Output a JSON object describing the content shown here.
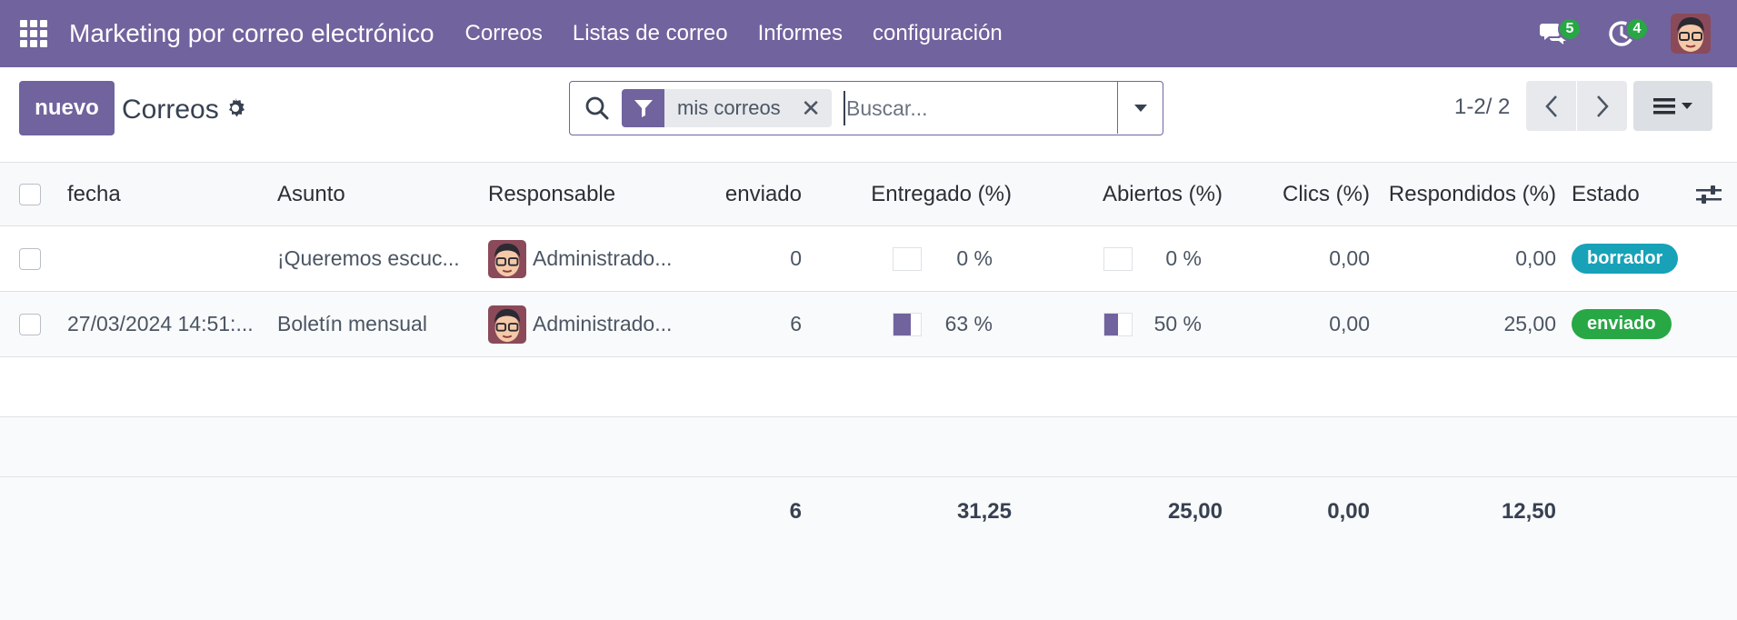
{
  "navbar": {
    "app_title": "Marketing por correo electrónico",
    "menu": [
      "Correos",
      "Listas de correo",
      "Informes",
      "configuración"
    ],
    "messages_count": "5",
    "activities_count": "4",
    "icons": [
      "apps-grid-icon",
      "chat-icon",
      "clock-icon",
      "user-avatar"
    ]
  },
  "control_panel": {
    "new_label": "nuevo",
    "title": "Correos",
    "search": {
      "facet_label": "mis correos",
      "placeholder": "Buscar..."
    },
    "pager": "1-2/ 2"
  },
  "table": {
    "headers": {
      "date": "fecha",
      "subject": "Asunto",
      "responsible": "Responsable",
      "sent": "enviado",
      "delivered": "Entregado (%)",
      "opened": "Abiertos (%)",
      "clicks": "Clics (%)",
      "replied": "Respondidos (%)",
      "state": "Estado"
    },
    "rows": [
      {
        "date": "",
        "subject": "¡Queremos escuc...",
        "responsible": "Administrado...",
        "sent": "0",
        "delivered_pct": 0,
        "delivered": "0 %",
        "opened_pct": 0,
        "opened": "0 %",
        "clicks": "0,00",
        "replied": "0,00",
        "state": "borrador",
        "state_color": "#17a2b8"
      },
      {
        "date": "27/03/2024 14:51:...",
        "subject": "Boletín mensual",
        "responsible": "Administrado...",
        "sent": "6",
        "delivered_pct": 63,
        "delivered": "63 %",
        "opened_pct": 50,
        "opened": "50 %",
        "clicks": "0,00",
        "replied": "25,00",
        "state": "enviado",
        "state_color": "#28a745"
      }
    ],
    "totals": {
      "sent": "6",
      "delivered": "31,25",
      "opened": "25,00",
      "clicks": "0,00",
      "replied": "12,50"
    }
  },
  "colors": {
    "brand": "#71639e",
    "badge_green": "#28a745"
  }
}
